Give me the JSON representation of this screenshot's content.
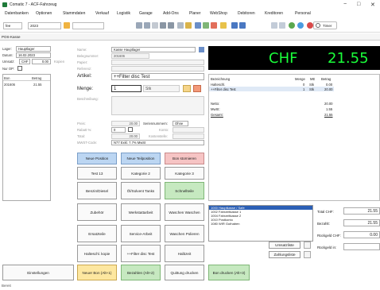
{
  "window": {
    "title": "Comatic 7 - ACF-Fahrzeug",
    "minimize": "−",
    "maximize": "□",
    "close": "✕"
  },
  "menu": [
    "Datenbanken",
    "Optionen",
    "Stammdaten",
    "Verkauf",
    "Logistik",
    "Garage",
    "Add-Ons",
    "Planer",
    "WebShop",
    "Debitoren",
    "Kreditoren",
    "Personal"
  ],
  "toolbar": {
    "field1": "fee",
    "year": "2023",
    "timer": "Timer"
  },
  "tab": "POS-Kasse",
  "left": {
    "lager_label": "Lager:",
    "lager": "Hauptlager",
    "datum_label": "Datum:",
    "datum": "16.02.2023",
    "umsatz_label": "Umsatz:",
    "umsatz_cur": "CHF",
    "umsatz_val": "0.00",
    "kopien_label": "Kopien",
    "nuroff_label": "Nur OP:",
    "col_bon": "Bon",
    "col_betrag": "Betrag",
    "rows": [
      {
        "bon": "201606",
        "betrag": "21.55"
      }
    ]
  },
  "form": {
    "name_label": "Name:",
    "name": "Kasse Hauptlager",
    "beleg_label": "Belegnummer:",
    "beleg": "201606",
    "papier_label": "Papier:",
    "ref_label": "Referenz:",
    "artikel_label": "Artikel:",
    "artikel": "++Filter disc Test",
    "menge_label": "Menge:",
    "menge": "1",
    "einheit": "Stk",
    "beschr_label": "Beschreibung:",
    "preis_label": "Preis:",
    "preis": "20.00",
    "serien_label": "Seriennummern:",
    "serien": "Ohne",
    "rabatt_label": "Rabatt %:",
    "rabatt": "0",
    "konto_label": "Konto:",
    "total_label": "Total:",
    "total": "20.00",
    "kosten_label": "Kostenstelle:",
    "mwst_label": "MWST-Code:",
    "mwst": "N77 Exkl. 7.7% MwSt"
  },
  "buttons": {
    "neue_position": "Neue Position",
    "neue_teilposition": "Neue Teilposition",
    "bon_stornieren": "Bon stornieren",
    "test13": "Test 13",
    "kat2": "Kategorie 2",
    "kat3": "Kategorie 3",
    "benzin": "Benzin/Diesel",
    "oel": "Öl/Solvent Tanks",
    "schnell": "Schnellteile",
    "zubehoer": "Zubehör",
    "werkstatt": "Werkstattarbeit",
    "waschen": "Waschen Waschen",
    "ersatz": "Ersatzteile",
    "service": "Service-Arbeit",
    "polieren": "Waschen Polieren",
    "halteschl": "Halteschl. kopie",
    "filter": "++Filter disc Test",
    "halbzeit": "Halbzeit",
    "einstellungen": "Einstellungen",
    "neuer_bon": "Neuer Bon (Alt+1)",
    "bezahlen": "Bezahlen (Alt+2)",
    "quittung": "Quittung drucken",
    "bon_drucken": "Bon drucken (Alt+3)",
    "umsatzliste": "Umsatzliste",
    "zahlungsliste": "Zahlungsliste"
  },
  "display": {
    "currency": "CHF",
    "amount": "21.55"
  },
  "receipt": {
    "col_bez": "Bezeichnung",
    "col_menge": "Menge",
    "col_me": "ME",
    "col_betrag": "Betrag",
    "lines": [
      {
        "bez": "Halteschl.",
        "menge": "0",
        "me": "Stk",
        "betrag": "0.00"
      },
      {
        "bez": "++Filter disc Test",
        "menge": "1",
        "me": "Stk",
        "betrag": "20.00"
      }
    ],
    "netto_label": "Netto:",
    "netto": "20.00",
    "mwst_label": "MwSt:",
    "mwst": "1.55",
    "gesamt_label": "Gesamt:",
    "gesamt": "21.55"
  },
  "payments": [
    {
      "text": "1000 Hauptkasse / Safe",
      "sel": true
    },
    {
      "text": "1002 Fahrzeitkasse 1"
    },
    {
      "text": "1004 Fahrzeitkasse 2"
    },
    {
      "text": "1010 Postkonto"
    },
    {
      "text": "1080 WIR Guthaben"
    }
  ],
  "totals": {
    "total_label": "Total CHF:",
    "total": "21.55",
    "bezahlt_label": "Bezahlt:",
    "bezahlt": "21.55",
    "rueck_label": "Rückgeld CHF:",
    "rueck": "0.00",
    "rueckeur_label": "Rückgeld in:",
    "rueckeur": ""
  },
  "status": "Bereit",
  "colors": {
    "accent": "#1aff3a",
    "selected": "#2b5fb5"
  }
}
